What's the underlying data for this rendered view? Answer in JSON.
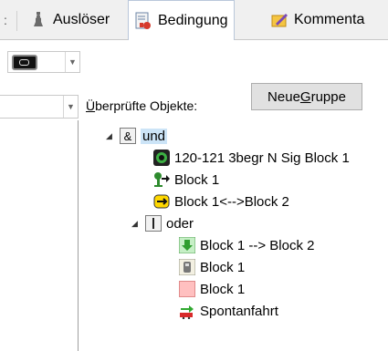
{
  "tabs": [
    {
      "label": "Auslöser",
      "active": false
    },
    {
      "label": "Bedingung",
      "active": true
    },
    {
      "label": "Kommenta",
      "active": false
    }
  ],
  "toolbar": {
    "checked_objects_label": "Überprüfte Objekte:",
    "new_group_button": "Neue Gruppe"
  },
  "tree": {
    "root": {
      "label": "und",
      "icon": "and-icon"
    },
    "items": [
      {
        "label": "120-121 3begr N Sig Block 1",
        "icon": "signal-icon"
      },
      {
        "label": "Block 1",
        "icon": "train-arrow-icon"
      },
      {
        "label": "Block 1<-->Block 2",
        "icon": "route-icon"
      }
    ],
    "group": {
      "label": "oder",
      "icon": "or-icon"
    },
    "group_items": [
      {
        "label": "Block 1 --> Block 2",
        "icon": "green-arrow-icon"
      },
      {
        "label": "Block 1",
        "icon": "block-occupied-icon"
      },
      {
        "label": "Block 1",
        "icon": "block-free-icon"
      },
      {
        "label": "Spontanfahrt",
        "icon": "spontaneous-icon"
      }
    ]
  },
  "colors": {
    "selection": "#cce4f7",
    "tab_border": "#b9c7da",
    "tree_bg": "#ffffff"
  }
}
